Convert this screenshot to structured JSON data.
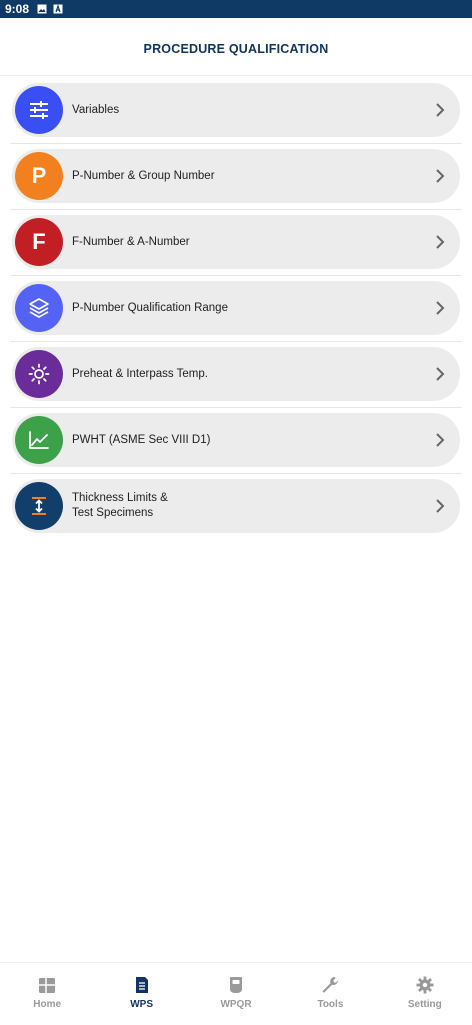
{
  "status_bar": {
    "time": "9:08"
  },
  "header": {
    "title": "PROCEDURE QUALIFICATION"
  },
  "menu": [
    {
      "label": "Variables",
      "color": "#3a4ff3",
      "icon": "sliders-icon"
    },
    {
      "label": "P-Number & Group Number",
      "color": "#f2801e",
      "icon": "letter-p-icon",
      "letter": "P"
    },
    {
      "label": "F-Number & A-Number",
      "color": "#c21f24",
      "icon": "letter-f-icon",
      "letter": "F"
    },
    {
      "label": "P-Number Qualification Range",
      "color": "#5563f5",
      "icon": "layers-icon"
    },
    {
      "label": "Preheat & Interpass Temp.",
      "color": "#6a2c98",
      "icon": "sun-icon"
    },
    {
      "label": "PWHT (ASME Sec VIII D1)",
      "color": "#3da14a",
      "icon": "line-chart-icon"
    },
    {
      "label_line1": "Thickness Limits &",
      "label_line2": "Test Specimens",
      "color": "#123e6b",
      "icon": "thickness-icon"
    }
  ],
  "nav": [
    {
      "label": "Home",
      "icon": "home-grid-icon"
    },
    {
      "label": "WPS",
      "icon": "document-icon",
      "active": true
    },
    {
      "label": "WPQR",
      "icon": "welder-mask-icon"
    },
    {
      "label": "Tools",
      "icon": "wrench-icon"
    },
    {
      "label": "Setting",
      "icon": "gear-icon"
    }
  ]
}
